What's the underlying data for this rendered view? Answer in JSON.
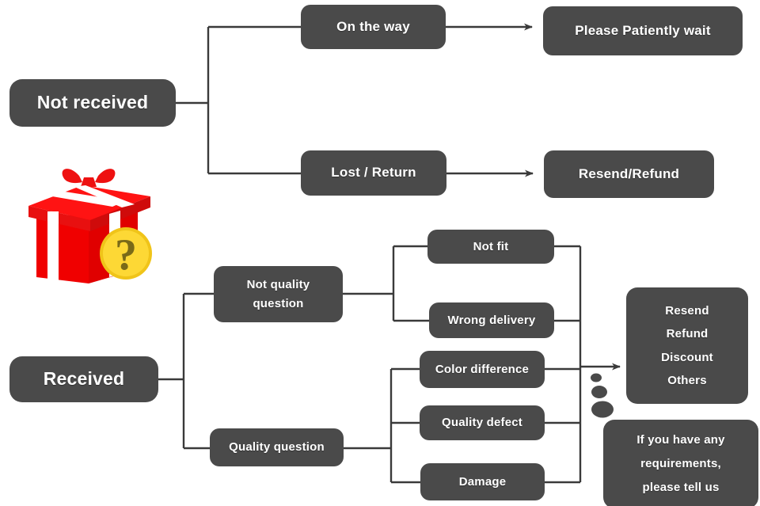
{
  "diagram": {
    "title": "Order issue resolution flowchart",
    "background_color": "#ffffff",
    "node_color": "#4a4a4a",
    "node_text_color": "#ffffff",
    "line_color": "#3a3a3a"
  },
  "icon": {
    "name": "gift-box-with-question-mark",
    "box_color": "#ee1111",
    "ribbon_color": "#ffffff",
    "badge_color": "#f8cf28",
    "badge_glyph": "?"
  },
  "nodes": {
    "not_received": "Not received",
    "on_the_way": "On the way",
    "please_patiently_wait": "Please Patiently wait",
    "lost_return": "Lost / Return",
    "resend_refund": "Resend/Refund",
    "received": "Received",
    "not_quality_question_l1": "Not quality",
    "not_quality_question_l2": "question",
    "quality_question": "Quality question",
    "not_fit": "Not fit",
    "wrong_delivery": "Wrong delivery",
    "color_difference": "Color difference",
    "quality_defect": "Quality defect",
    "damage": "Damage",
    "resolution_1": "Resend",
    "resolution_2": "Refund",
    "resolution_3": "Discount",
    "resolution_4": "Others",
    "note_l1": "If you have any",
    "note_l2": "requirements,",
    "note_l3": "please tell us"
  },
  "flow": {
    "branches": [
      {
        "from": "Not received",
        "to": [
          "On the way",
          "Lost / Return"
        ]
      },
      {
        "from": "On the way",
        "to": [
          "Please Patiently wait"
        ],
        "arrow": true
      },
      {
        "from": "Lost / Return",
        "to": [
          "Resend/Refund"
        ],
        "arrow": true
      },
      {
        "from": "Received",
        "to": [
          "Not quality question",
          "Quality question"
        ]
      },
      {
        "from": "Not quality question",
        "to": [
          "Not fit",
          "Wrong delivery"
        ]
      },
      {
        "from": "Quality question",
        "to": [
          "Color difference",
          "Quality defect",
          "Damage"
        ]
      },
      {
        "from": [
          "Not fit",
          "Wrong delivery",
          "Color difference",
          "Quality defect",
          "Damage"
        ],
        "to": [
          "Resend / Refund / Discount / Others"
        ],
        "arrow": true
      }
    ]
  }
}
